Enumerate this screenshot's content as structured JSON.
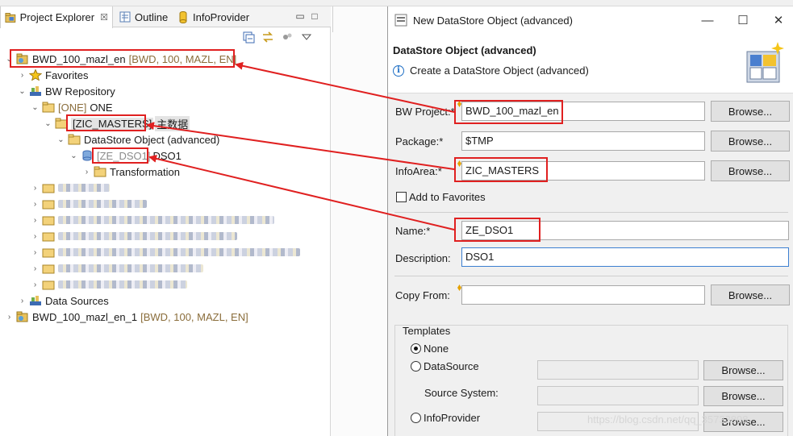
{
  "explorer": {
    "tabs": [
      {
        "label": "Project Explorer",
        "close": "☒"
      },
      {
        "label": "Outline"
      },
      {
        "label": "InfoProvider"
      }
    ],
    "tree": {
      "project": {
        "name": "BWD_100_mazl_en",
        "meta": "[BWD, 100, MAZL, EN]"
      },
      "favorites": "Favorites",
      "repository": "BW Repository",
      "one_tag": "[ONE]",
      "one_name": "ONE",
      "zic_tag": "[ZIC_MASTERS]",
      "zic_suffix": "主数据",
      "dso_folder": "DataStore Object (advanced)",
      "dso_tag": "[ZE_DSO1]",
      "dso_name": "DSO1",
      "transformation": "Transformation",
      "data_sources": "Data Sources",
      "project2": {
        "name": "BWD_100_mazl_en_1",
        "meta": "[BWD, 100, MAZL, EN]"
      }
    }
  },
  "dialog": {
    "window_title": "New DataStore Object (advanced)",
    "header_title": "DataStore Object (advanced)",
    "header_desc": "Create a DataStore Object (advanced)",
    "fields": {
      "bw_project": {
        "label": "BW Project:*",
        "value": "BWD_100_mazl_en"
      },
      "package": {
        "label": "Package:*",
        "value": "$TMP"
      },
      "infoarea": {
        "label": "InfoArea:*",
        "value": "ZIC_MASTERS"
      },
      "favorites": {
        "label": "Add to Favorites"
      },
      "name": {
        "label": "Name:*",
        "value": "ZE_DSO1"
      },
      "description": {
        "label": "Description:",
        "value": "DSO1"
      },
      "copy_from": {
        "label": "Copy From:",
        "value": ""
      }
    },
    "browse_label": "Browse...",
    "templates": {
      "title": "Templates",
      "none": "None",
      "datasource": "DataSource",
      "source_system": "Source System:",
      "infoprovider": "InfoProvider"
    }
  },
  "watermark": "https://blog.csdn.net/qq_35733898",
  "colors": {
    "annotation": "#e02020",
    "focus": "#3c7fd1"
  }
}
